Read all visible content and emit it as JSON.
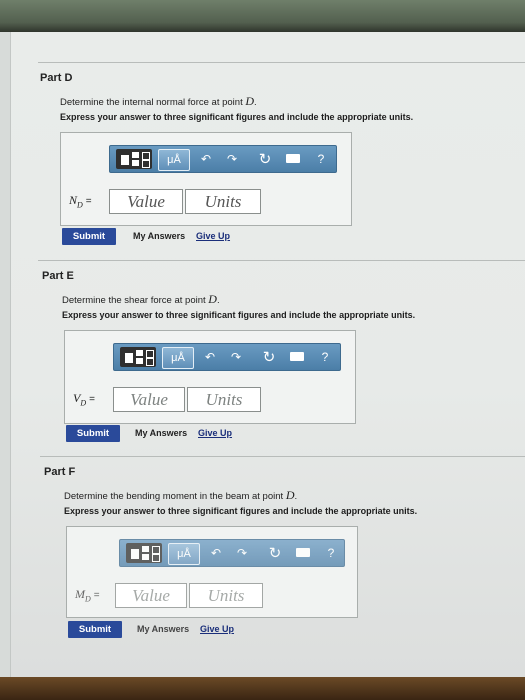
{
  "parts": [
    {
      "title": "Part D",
      "prompt_text": "Determine the internal normal force at point",
      "prompt_point": "D",
      "instruction": "Express your answer to three significant figures and include the appropriate units.",
      "variable_label": "N",
      "variable_sub": "D",
      "equals": "=",
      "value_placeholder": "Value",
      "units_placeholder": "Units",
      "submit_label": "Submit",
      "my_answers_label": "My Answers",
      "give_up_label": "Give Up"
    },
    {
      "title": "Part E",
      "prompt_text": "Determine the shear force at point",
      "prompt_point": "D",
      "instruction": "Express your answer to three significant figures and include the appropriate units.",
      "variable_label": "V",
      "variable_sub": "D",
      "equals": "=",
      "value_placeholder": "Value",
      "units_placeholder": "Units",
      "submit_label": "Submit",
      "my_answers_label": "My Answers",
      "give_up_label": "Give Up"
    },
    {
      "title": "Part F",
      "prompt_text": "Determine the bending moment in the beam at point",
      "prompt_point": "D",
      "instruction": "Express your answer to three significant figures and include the appropriate units.",
      "variable_label": "M",
      "variable_sub": "D",
      "equals": "=",
      "value_placeholder": "Value",
      "units_placeholder": "Units",
      "submit_label": "Submit",
      "my_answers_label": "My Answers",
      "give_up_label": "Give Up"
    }
  ],
  "toolbar": {
    "units_button_label": "μÅ",
    "help_label": "?",
    "icons": [
      "templates-icon",
      "units-icon",
      "undo-icon",
      "redo-icon",
      "reset-icon",
      "keyboard-icon",
      "help-icon"
    ]
  },
  "colors": {
    "toolbar_blue": "#4b7ea7",
    "submit_blue": "#2a4a9a",
    "link_blue": "#1a2e7a"
  }
}
